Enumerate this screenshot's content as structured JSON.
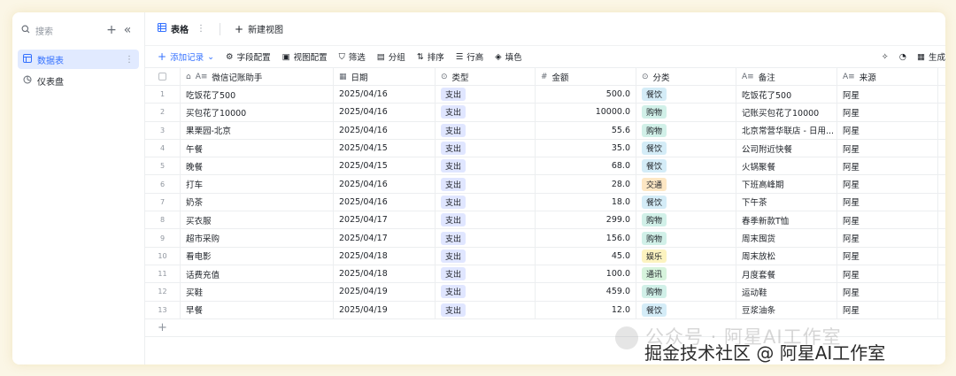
{
  "sidebar": {
    "search_placeholder": "搜索",
    "items": [
      {
        "label": "数据表",
        "active": true
      },
      {
        "label": "仪表盘",
        "active": false
      }
    ]
  },
  "tabs": [
    {
      "label": "表格",
      "active": true
    },
    {
      "label": "新建视图",
      "active": false
    }
  ],
  "toolbar": {
    "add_record": "添加记录",
    "field_config": "字段配置",
    "view_config": "视图配置",
    "filter": "筛选",
    "group": "分组",
    "sort": "排序",
    "row_height": "行高",
    "fill": "填色",
    "right_label": "生成"
  },
  "columns": [
    {
      "label": "微信记账助手",
      "icon": "text-field-icon"
    },
    {
      "label": "日期",
      "icon": "calendar-icon"
    },
    {
      "label": "类型",
      "icon": "single-select-icon"
    },
    {
      "label": "金额",
      "icon": "number-icon"
    },
    {
      "label": "分类",
      "icon": "single-select-icon"
    },
    {
      "label": "备注",
      "icon": "text-field-icon"
    },
    {
      "label": "来源",
      "icon": "text-field-icon"
    }
  ],
  "rows": [
    {
      "no": "1",
      "name": "吃饭花了500",
      "date": "2025/04/16",
      "type": "支出",
      "amount": "500.0",
      "category": "餐饮",
      "cat_color": "#d4ecf7",
      "note": "吃饭花了500",
      "source": "阿星"
    },
    {
      "no": "2",
      "name": "买包花了10000",
      "date": "2025/04/16",
      "type": "支出",
      "amount": "10000.0",
      "category": "购物",
      "cat_color": "#d1f0e8",
      "note": "记账买包花了10000",
      "source": "阿星"
    },
    {
      "no": "3",
      "name": "果栗园-北京",
      "date": "2025/04/16",
      "type": "支出",
      "amount": "55.6",
      "category": "购物",
      "cat_color": "#d1f0e8",
      "note": "北京常营华联店 - 日用...",
      "source": "阿星"
    },
    {
      "no": "4",
      "name": "午餐",
      "date": "2025/04/15",
      "type": "支出",
      "amount": "35.0",
      "category": "餐饮",
      "cat_color": "#d4ecf7",
      "note": "公司附近快餐",
      "source": "阿星"
    },
    {
      "no": "5",
      "name": "晚餐",
      "date": "2025/04/15",
      "type": "支出",
      "amount": "68.0",
      "category": "餐饮",
      "cat_color": "#d4ecf7",
      "note": "火锅聚餐",
      "source": "阿星"
    },
    {
      "no": "6",
      "name": "打车",
      "date": "2025/04/16",
      "type": "支出",
      "amount": "28.0",
      "category": "交通",
      "cat_color": "#fde7c4",
      "note": "下班高峰期",
      "source": "阿星"
    },
    {
      "no": "7",
      "name": "奶茶",
      "date": "2025/04/16",
      "type": "支出",
      "amount": "18.0",
      "category": "餐饮",
      "cat_color": "#d4ecf7",
      "note": "下午茶",
      "source": "阿星"
    },
    {
      "no": "8",
      "name": "买衣服",
      "date": "2025/04/17",
      "type": "支出",
      "amount": "299.0",
      "category": "购物",
      "cat_color": "#d1f0e8",
      "note": "春季新款T恤",
      "source": "阿星"
    },
    {
      "no": "9",
      "name": "超市采购",
      "date": "2025/04/17",
      "type": "支出",
      "amount": "156.0",
      "category": "购物",
      "cat_color": "#d1f0e8",
      "note": "周末囤货",
      "source": "阿星"
    },
    {
      "no": "10",
      "name": "看电影",
      "date": "2025/04/18",
      "type": "支出",
      "amount": "45.0",
      "category": "娱乐",
      "cat_color": "#fcf3c0",
      "note": "周末放松",
      "source": "阿星"
    },
    {
      "no": "11",
      "name": "话费充值",
      "date": "2025/04/18",
      "type": "支出",
      "amount": "100.0",
      "category": "通讯",
      "cat_color": "#d6f3dc",
      "note": "月度套餐",
      "source": "阿星"
    },
    {
      "no": "12",
      "name": "买鞋",
      "date": "2025/04/19",
      "type": "支出",
      "amount": "459.0",
      "category": "购物",
      "cat_color": "#d1f0e8",
      "note": "运动鞋",
      "source": "阿星"
    },
    {
      "no": "13",
      "name": "早餐",
      "date": "2025/04/19",
      "type": "支出",
      "amount": "12.0",
      "category": "餐饮",
      "cat_color": "#d4ecf7",
      "note": "豆浆油条",
      "source": "阿星"
    }
  ],
  "watermark": {
    "line1": "公众号 · 阿星AI工作室",
    "line2": "掘金技术社区 @ 阿星AI工作室"
  }
}
